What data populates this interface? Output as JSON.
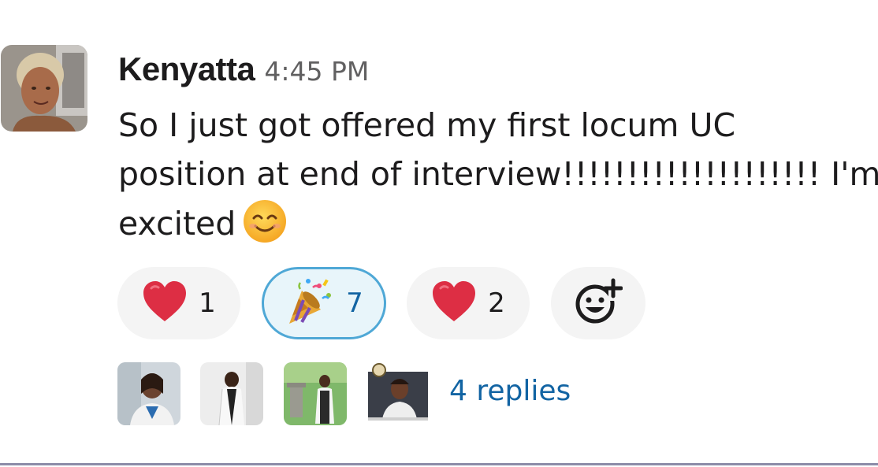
{
  "message": {
    "author": "Kenyatta",
    "timestamp": "4:45 PM",
    "lines": [
      "So I just got offered my first locum UC",
      "position at end of interview!!!!!!!!!!!!!!!!!!!! I'm",
      "excited"
    ],
    "inline_emoji": "smiling-face-emoji"
  },
  "reactions": [
    {
      "emoji": "red-heart",
      "count": "1",
      "active": false
    },
    {
      "emoji": "party-popper",
      "count": "7",
      "active": true
    },
    {
      "emoji": "red-heart",
      "count": "2",
      "active": false
    }
  ],
  "add_reaction_icon": "add-reaction-icon",
  "thread": {
    "participant_count": 4,
    "replies_label": "4 replies"
  },
  "colors": {
    "text": "#1d1c1d",
    "timestamp": "#616061",
    "link": "#1264a3",
    "reaction_bg": "#f4f4f4",
    "reaction_active_bg": "#e8f5fa",
    "reaction_active_border": "#4fa8d6"
  }
}
